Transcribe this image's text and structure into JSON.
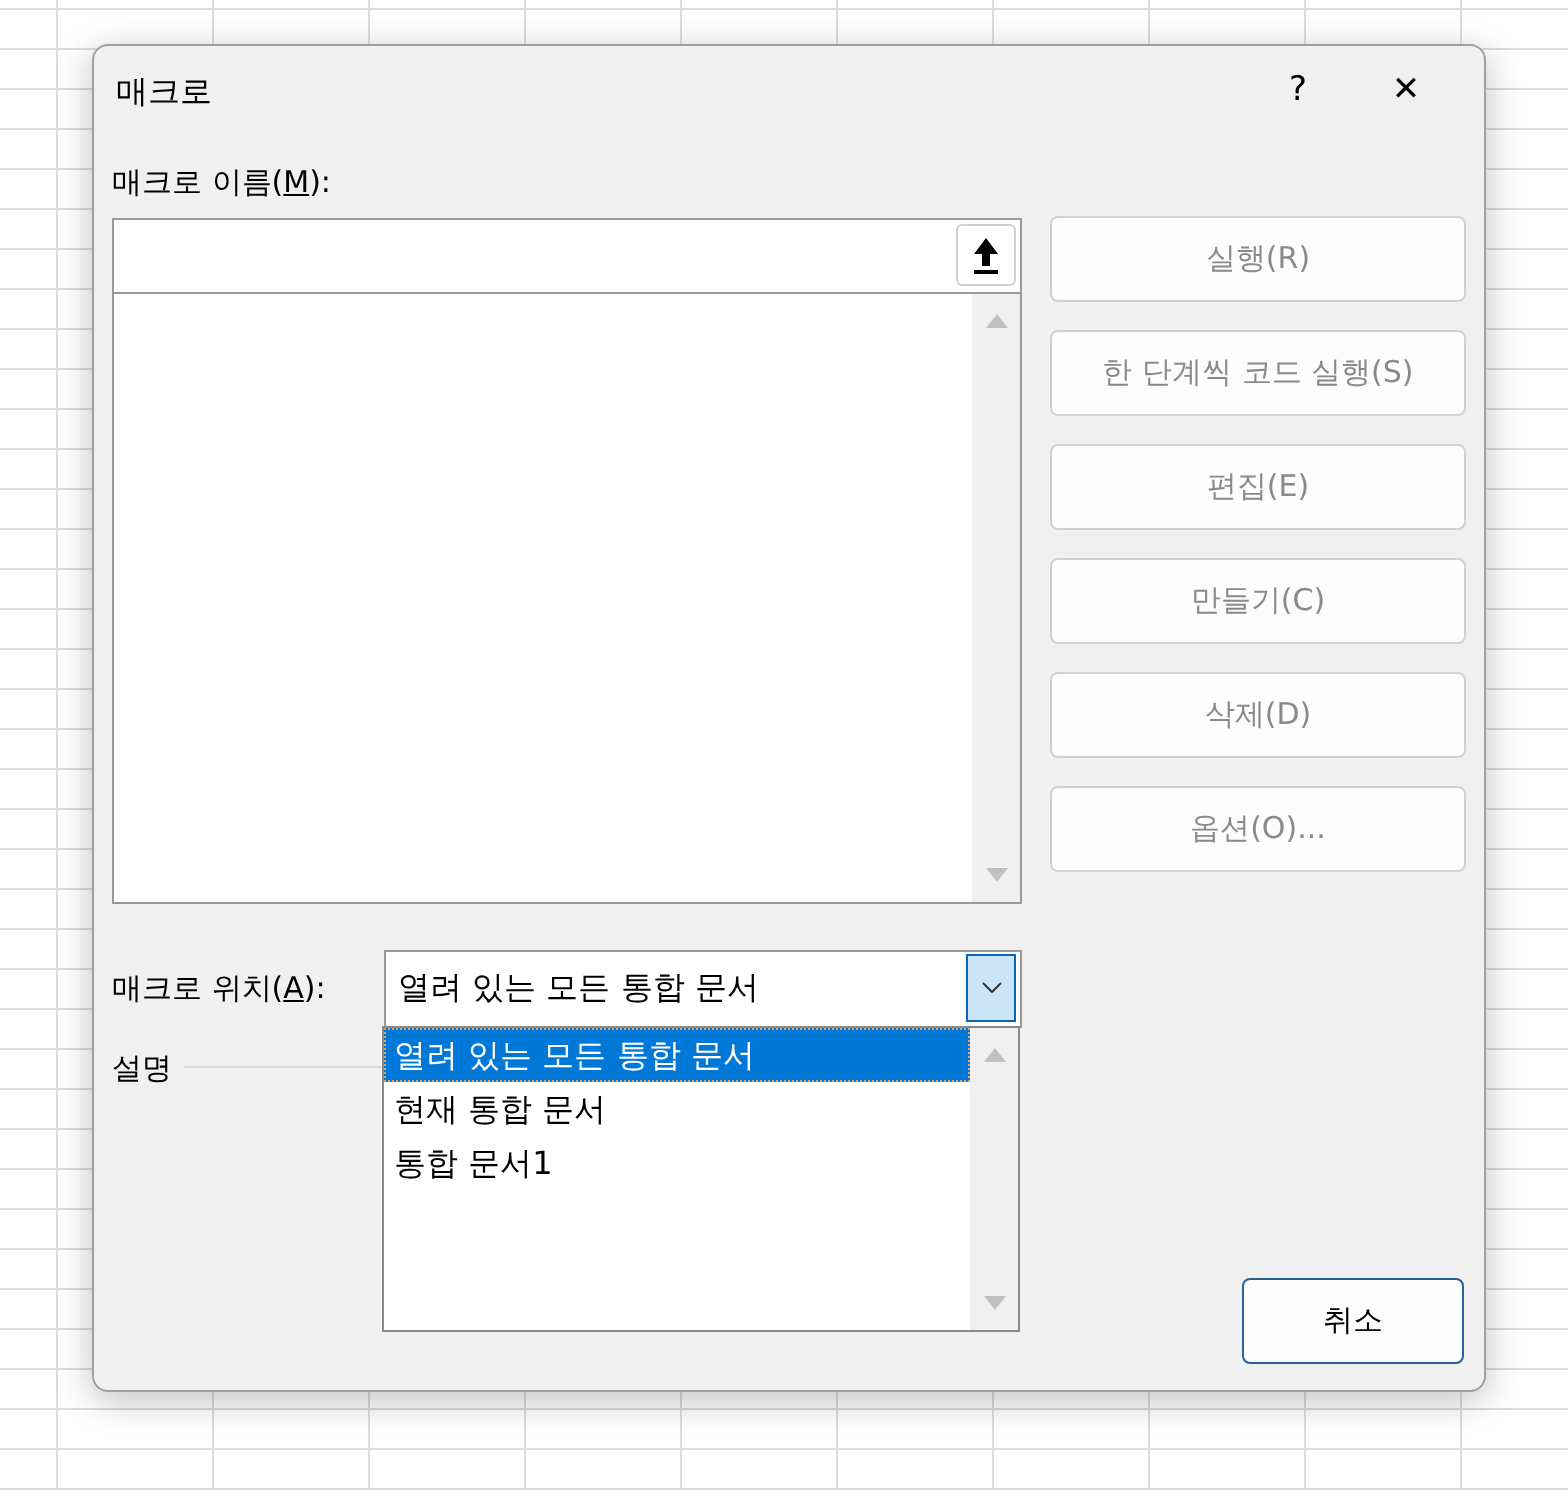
{
  "window": {
    "title": "매크로",
    "help": "?",
    "close": "✕"
  },
  "macro_name": {
    "label": "매크로 이름(M):"
  },
  "buttons": [
    {
      "label": "실행(R)",
      "disabled": true
    },
    {
      "label": "한 단계씩 코드 실행(S)",
      "disabled": true
    },
    {
      "label": "편집(E)",
      "disabled": true
    },
    {
      "label": "만들기(C)",
      "disabled": true
    },
    {
      "label": "삭제(D)",
      "disabled": true
    },
    {
      "label": "옵션(O)...",
      "disabled": true
    }
  ],
  "macro_location": {
    "label": "매크로 위치(A):",
    "value": "열려 있는 모든 통합 문서",
    "expanded": true,
    "options": [
      {
        "label": "열려 있는 모든 통합 문서",
        "selected": true
      },
      {
        "label": "현재 통합 문서",
        "selected": false
      },
      {
        "label": "통합 문서1",
        "selected": false
      }
    ]
  },
  "description": {
    "label": "설명"
  },
  "cancel_button": {
    "label": "취소",
    "disabled": false
  }
}
